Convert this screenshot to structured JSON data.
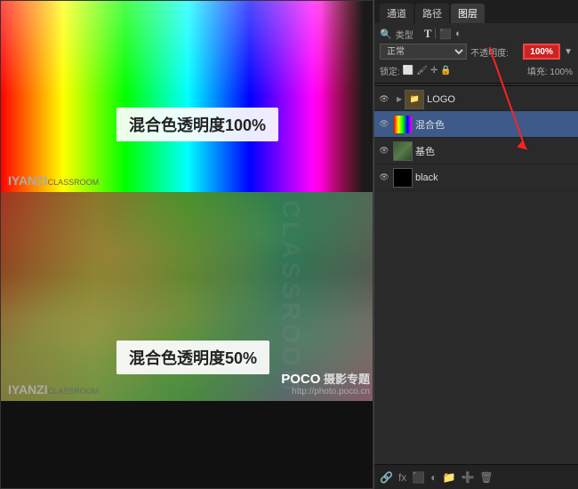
{
  "tabs": [
    "通道",
    "路径",
    "图层"
  ],
  "toolbar": {
    "search_icon": "🔍",
    "type_label": "类型",
    "mode_label": "正常",
    "opacity_label": "不透明度:",
    "opacity_value": "100%",
    "lock_label": "锁定:",
    "fill_label": "填充: 100%"
  },
  "layers": [
    {
      "name": "LOGO",
      "type": "folder",
      "visible": true,
      "selected": false
    },
    {
      "name": "混合色",
      "type": "rainbow",
      "visible": true,
      "selected": true
    },
    {
      "name": "基色",
      "type": "green",
      "visible": true,
      "selected": false
    },
    {
      "name": "black",
      "type": "black",
      "visible": true,
      "selected": false
    }
  ],
  "annotations": {
    "label_100": "混合色透明度100%",
    "label_50": "混合色透明度50%"
  },
  "branding": {
    "iyanzi": "IYANZI",
    "classroom": "CLASSROOM",
    "poco": "POCO 摄影专题",
    "poco_url": "http://photo.poco.cn"
  }
}
